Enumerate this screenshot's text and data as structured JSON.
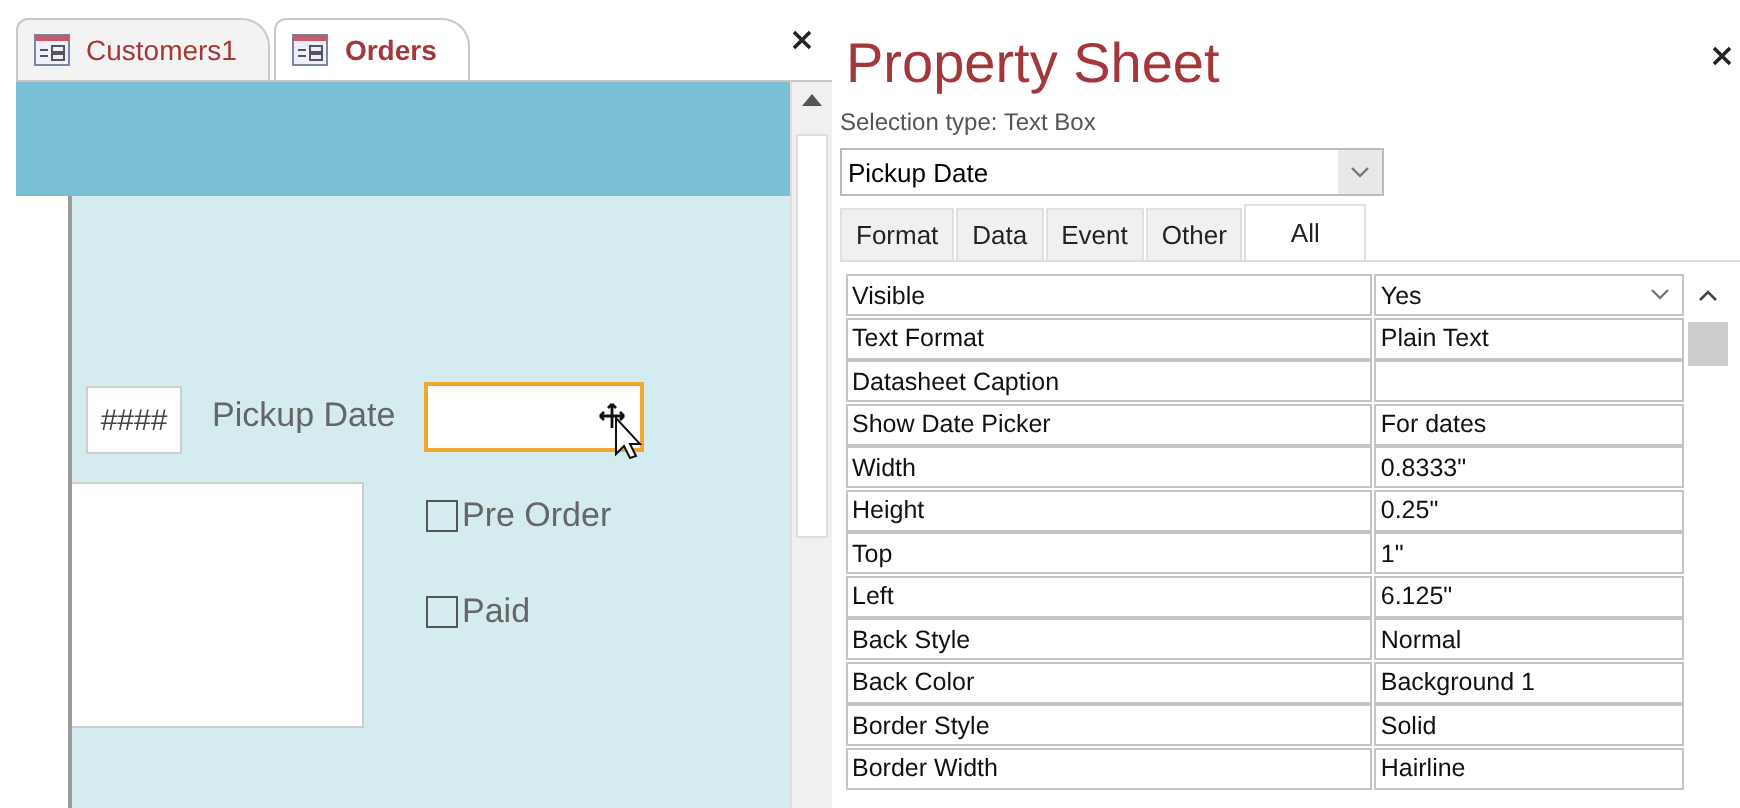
{
  "document_tabs": [
    {
      "label": "Customers1",
      "selected": false
    },
    {
      "label": "Orders",
      "selected": true
    }
  ],
  "form": {
    "number_box": {
      "value": "####"
    },
    "pickup_label": "Pickup Date",
    "pickup_field": {
      "selected": true
    },
    "checkboxes": [
      {
        "label": "Pre Order",
        "checked": false
      },
      {
        "label": "Paid",
        "checked": false
      }
    ]
  },
  "property_sheet": {
    "title": "Property Sheet",
    "selection_type": "Selection type: Text Box",
    "object_select": {
      "value": "Pickup Date"
    },
    "tabs": [
      {
        "label": "Format",
        "selected": false
      },
      {
        "label": "Data",
        "selected": false
      },
      {
        "label": "Event",
        "selected": false
      },
      {
        "label": "Other",
        "selected": false
      },
      {
        "label": "All",
        "selected": true
      }
    ],
    "properties": [
      {
        "name": "Visible",
        "value": "Yes",
        "kind": "dropdown"
      },
      {
        "name": "Text Format",
        "value": "Plain Text",
        "kind": "text"
      },
      {
        "name": "Datasheet Caption",
        "kind": "text"
      },
      {
        "name": "Show Date Picker",
        "value": "For dates",
        "kind": "text"
      },
      {
        "name": "Width",
        "value": "0.8333\"",
        "kind": "text"
      },
      {
        "name": "Height",
        "value": "0.25\"",
        "kind": "text"
      },
      {
        "name": "Top",
        "value": "1\"",
        "kind": "text"
      },
      {
        "name": "Left",
        "value": "6.125\"",
        "kind": "text"
      },
      {
        "name": "Back Style",
        "value": "Normal",
        "kind": "text"
      },
      {
        "name": "Back Color",
        "value": "Background 1",
        "kind": "text"
      },
      {
        "name": "Border Style",
        "value": "Solid",
        "kind": "text"
      },
      {
        "name": "Border Width",
        "value": "Hairline",
        "kind": "text"
      }
    ]
  }
}
